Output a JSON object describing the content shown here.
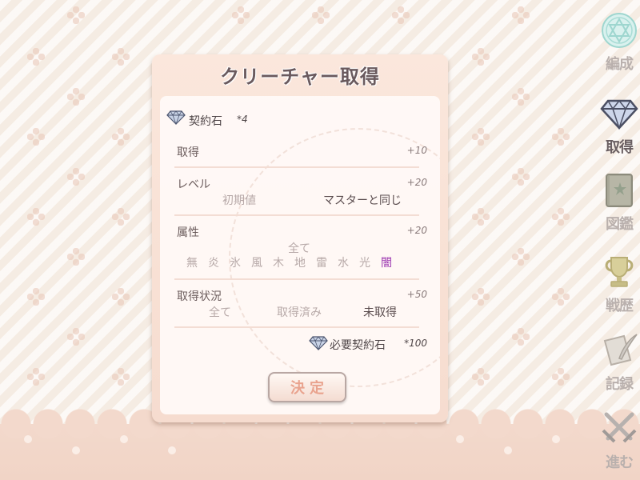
{
  "panel": {
    "title": "クリーチャー取得"
  },
  "stones": {
    "label": "契約石",
    "count": "*4"
  },
  "rows": {
    "acquire": {
      "label": "取得",
      "cost": "+10"
    },
    "level": {
      "label": "レベル",
      "cost": "+20",
      "options": [
        "初期値",
        "マスターと同じ"
      ]
    },
    "attribute": {
      "label": "属性",
      "cost": "+20",
      "all": "全て",
      "elements": [
        "無",
        "炎",
        "氷",
        "風",
        "木",
        "地",
        "雷",
        "水",
        "光",
        "闇"
      ]
    },
    "status": {
      "label": "取得状況",
      "cost": "+50",
      "options": [
        "全て",
        "取得済み",
        "未取得"
      ]
    }
  },
  "required": {
    "label": "必要契約石",
    "count": "*100"
  },
  "confirm_button": "決定",
  "side_menu": [
    {
      "label": "編成",
      "icon": "hexagram-icon"
    },
    {
      "label": "取得",
      "icon": "diamond-icon",
      "active": true
    },
    {
      "label": "図鑑",
      "icon": "book-icon"
    },
    {
      "label": "戦歴",
      "icon": "trophy-icon"
    },
    {
      "label": "記録",
      "icon": "quill-scroll-icon"
    },
    {
      "label": "進む",
      "icon": "crossed-swords-icon"
    }
  ],
  "colors": {
    "selected_element": "#9b35b0",
    "active_menu": "#6a5f62",
    "inactive_menu": "#b9b0ad"
  }
}
